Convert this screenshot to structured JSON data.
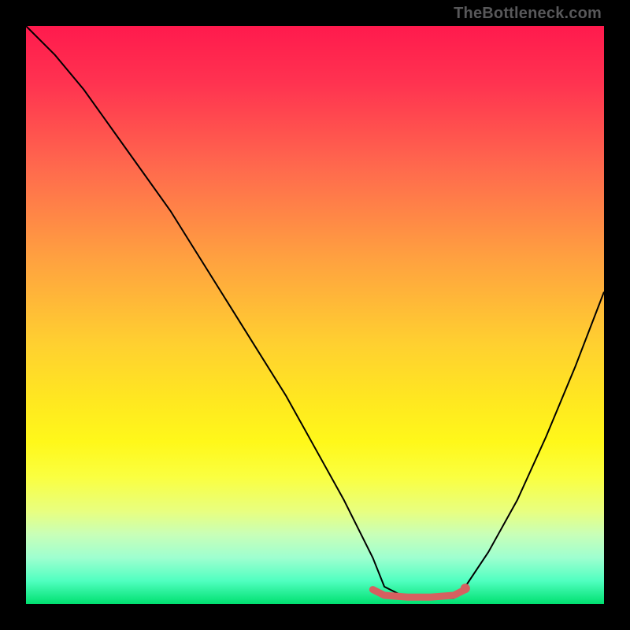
{
  "watermark": "TheBottleneck.com",
  "chart_data": {
    "type": "line",
    "title": "",
    "xlabel": "",
    "ylabel": "",
    "xlim": [
      0,
      100
    ],
    "ylim": [
      0,
      100
    ],
    "gradient_background": {
      "top_color": "#ff1a4d",
      "mid_color": "#fff81a",
      "bottom_color": "#00e070"
    },
    "series": [
      {
        "name": "bottleneck-curve",
        "color": "#000000",
        "stroke_width": 2,
        "x": [
          0,
          5,
          10,
          15,
          20,
          25,
          30,
          35,
          40,
          45,
          50,
          55,
          60,
          62,
          66,
          70,
          74,
          76,
          80,
          85,
          90,
          95,
          100
        ],
        "y": [
          100,
          95,
          89,
          82,
          75,
          68,
          60,
          52,
          44,
          36,
          27,
          18,
          8,
          3,
          1,
          1,
          1,
          3,
          9,
          18,
          29,
          41,
          54
        ]
      },
      {
        "name": "optimal-band",
        "color": "#d66060",
        "stroke_width": 9,
        "cap": "round",
        "x": [
          60,
          62,
          66,
          70,
          74,
          76
        ],
        "y": [
          2.5,
          1.5,
          1.2,
          1.2,
          1.5,
          2.5
        ]
      }
    ],
    "marker": {
      "x": 76,
      "y": 2.7,
      "r": 6,
      "color": "#d66060"
    }
  }
}
